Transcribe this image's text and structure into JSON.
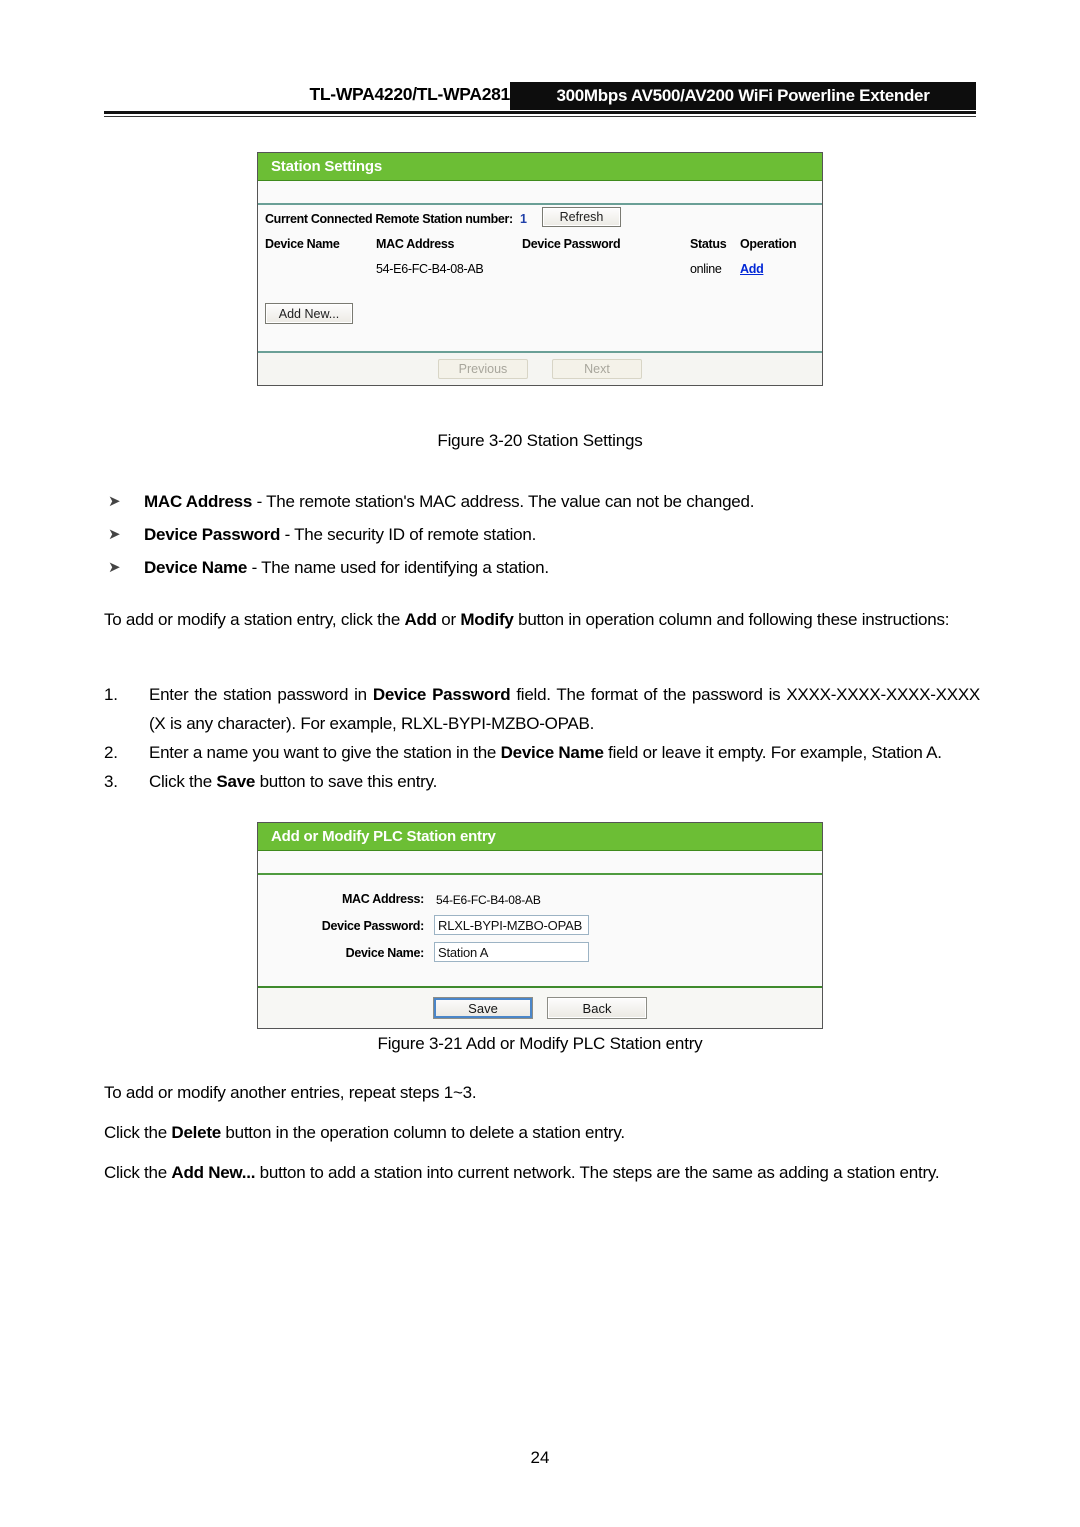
{
  "header": {
    "left_title": "TL-WPA4220/TL-WPA281",
    "product_banner": "300Mbps AV500/AV200 WiFi Powerline Extender"
  },
  "station_settings_panel": {
    "title": "Station Settings",
    "count_label": "Current Connected Remote Station number:",
    "count_value": "1",
    "refresh_button": "Refresh",
    "columns": [
      "Device Name",
      "MAC Address",
      "Device Password",
      "Status",
      "Operation"
    ],
    "rows": [
      {
        "device_name": "",
        "mac_address": "54-E6-FC-B4-08-AB",
        "device_password": "",
        "status": "online",
        "operation": "Add"
      }
    ],
    "add_new_button": "Add New...",
    "previous_button": "Previous",
    "next_button": "Next"
  },
  "figure_3_20_caption": "Figure 3-20 Station Settings",
  "bullets": [
    {
      "arrow": "arrow-bullet",
      "term": "MAC Address",
      "desc": " - The remote station's MAC address. The value can not be changed."
    },
    {
      "arrow": "arrow-bullet",
      "term": "Device Password",
      "desc": " - The security ID of remote station."
    },
    {
      "arrow": "arrow-bullet",
      "term": "Device Name",
      "desc": " - The name used for identifying a station."
    }
  ],
  "intro_paragraph": {
    "part1": "To add or modify a station entry, click the ",
    "bold1": "Add",
    "part2": " or ",
    "bold2": "Modify",
    "part3": " button in operation column and following these instructions:"
  },
  "steps": [
    {
      "num": "1.",
      "part1": "Enter the station password in ",
      "bold1": "Device Password",
      "part2": " field. The format of the password is XXXX-XXXX-XXXX-XXXX (X is any character). For example, RLXL-BYPI-MZBO-OPAB."
    },
    {
      "num": "2.",
      "part1": "Enter a name you want to give the station in the ",
      "bold1": "Device Name",
      "part2": " field or leave it empty. For example, Station A."
    },
    {
      "num": "3.",
      "part1": "Click the ",
      "bold1": "Save",
      "part2": " button to save this entry."
    }
  ],
  "add_modify_panel": {
    "title": "Add or Modify PLC Station entry",
    "mac_label": "MAC Address:",
    "mac_value": "54-E6-FC-B4-08-AB",
    "password_label": "Device Password:",
    "password_value": "RLXL-BYPI-MZBO-OPAB",
    "name_label": "Device Name:",
    "name_value": "Station A",
    "save_button": "Save",
    "back_button": "Back"
  },
  "figure_3_21_caption": "Figure 3-21 Add or Modify PLC Station entry",
  "closing_paragraphs": {
    "repeat": "To add or modify another entries, repeat steps 1~3.",
    "delete_part1": "Click the ",
    "delete_bold": "Delete",
    "delete_part2": " button in the operation column to delete a station entry.",
    "addnew_part1": "Click the ",
    "addnew_bold": "Add New...",
    "addnew_part2": " button to add a station into current network. The steps are the same as adding a station entry."
  },
  "page_number": "24",
  "colors": {
    "panel_green": "#6cbe35",
    "link_blue": "#0026d6",
    "count_blue": "#1f3fa8",
    "separator_teal": "#6a9f96",
    "banner_black": "#0d0d0d"
  }
}
